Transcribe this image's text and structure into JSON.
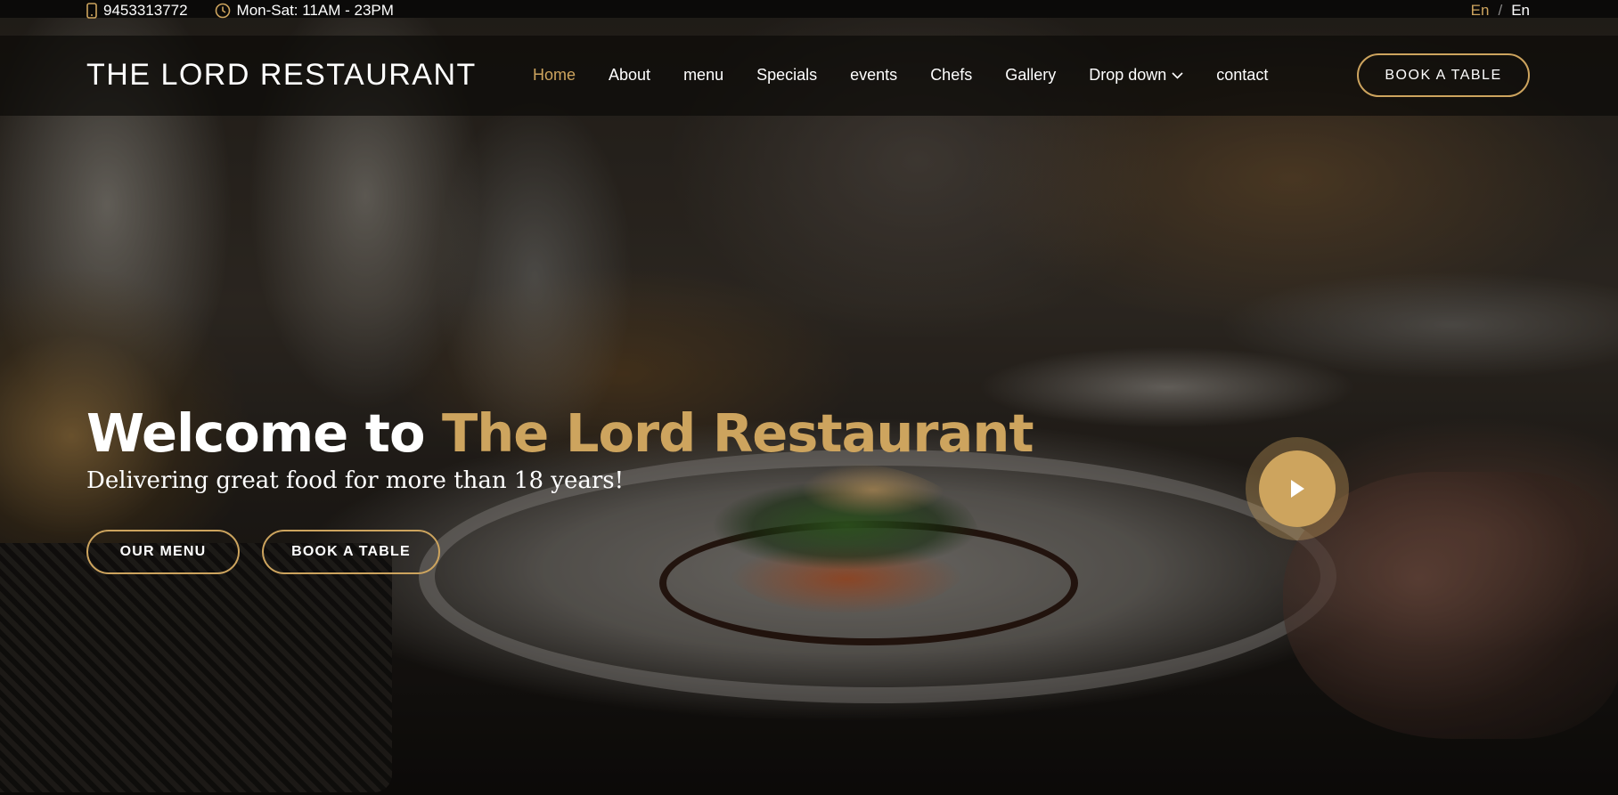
{
  "topbar": {
    "phone": "9453313772",
    "hours": "Mon-Sat: 11AM - 23PM",
    "lang_active": "En",
    "lang_separator": "/",
    "lang_other": "En"
  },
  "header": {
    "logo": "THE LORD RESTAURANT",
    "nav": [
      {
        "label": "Home",
        "active": true
      },
      {
        "label": "About"
      },
      {
        "label": "menu"
      },
      {
        "label": "Specials"
      },
      {
        "label": "events"
      },
      {
        "label": "Chefs"
      },
      {
        "label": "Gallery"
      },
      {
        "label": "Drop down"
      },
      {
        "label": "contact"
      }
    ],
    "book_button": "BOOK A TABLE"
  },
  "hero": {
    "title_prefix": "Welcome to",
    "title_accent": "The Lord Restaurant",
    "subtitle": "Delivering great food for more than 18 years!",
    "menu_button": "OUR MENU",
    "book_button": "BOOK A TABLE"
  },
  "icons": {
    "phone": "phone-icon",
    "clock": "clock-icon",
    "dropdown": "chevron-down-icon",
    "play": "play-icon"
  },
  "colors": {
    "accent": "#cda45e",
    "text": "#ffffff",
    "topbar_bg": "#0b0a09"
  }
}
